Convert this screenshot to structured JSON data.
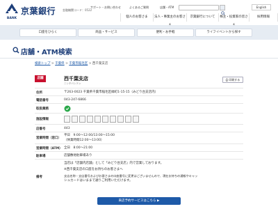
{
  "header": {
    "bank_name": "京葉銀行",
    "bank_code": "金融機関コード：0522",
    "support": "サポート・お問い合わせ",
    "faq": "よくあるご質問",
    "atm": "店舗・ATM",
    "search_placeholder": "",
    "lang": "English",
    "nav": [
      "個人のお客さま",
      "法人・事業主のお客さま",
      "京葉銀行について",
      "株主・投資家の皆さま",
      "採用情報"
    ]
  },
  "subnav": [
    "口座をひらく",
    "商品・サービス",
    "便利・お手軽",
    "ライフイベントから探す"
  ],
  "page_title": "店舗・ATM検索",
  "breadcrumb": {
    "top": "検索トップ",
    "sep": " > ",
    "pref": "千葉県",
    "city": "千葉市稲毛区",
    "current": "西千葉支店"
  },
  "branch": {
    "badge": "店舗",
    "name": "西千葉支店",
    "reading": "ニシチバシテン",
    "print": "印刷する"
  },
  "info": {
    "address_label": "住所",
    "address": "〒263-0023 千葉県千葉市稲毛区緑町1-15-15（みどり台支店内）",
    "tel_label": "電話番号",
    "tel": "043-247-6866",
    "service_label": "取扱業務",
    "facility_label": "施設情報",
    "store_no_label": "店番号",
    "store_no": "443",
    "hours_label": "営業時間（窓口）",
    "hours_1": "平日　9:00～12:00/13:00～15:00",
    "hours_2": "（休業時間12:00～13:00）",
    "atm_label": "営業時間（ATM）",
    "atm_hours": "全日　8:00～21:00",
    "parking_label": "駐車場",
    "parking": "店舗敷地駐車場あり",
    "remarks_label": "備考",
    "remarks": [
      "当店は「店舗内店舗」として「みどり台支店」内で営業しております。",
      "※西千葉支店の口座をお持ちのお客さまへ",
      "支店名称・支店番号およびお客さまの口座番号に変更はございませんので、現在お持ちの通帳やキャッ",
      "シュカードはいままで通りご利用いただけます。"
    ]
  },
  "cta": "来店予約サービスはこちら ▶",
  "colors": {
    "brand": "#1e3f7a",
    "badge": "#c8102e",
    "cta": "#1e5aa8",
    "subnav_bg": "#e6ecf3"
  }
}
